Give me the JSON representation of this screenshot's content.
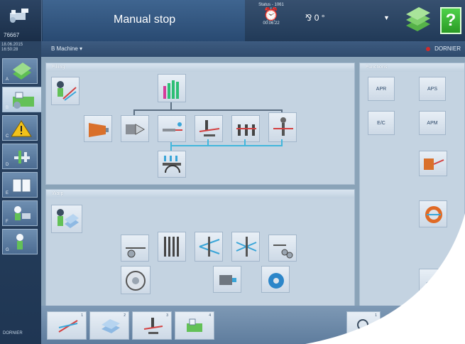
{
  "header": {
    "machine_id": "76667",
    "mode_title": "Manual stop",
    "status_label": "Status - 1061",
    "status_time": "00:06:22",
    "angle": "0 °",
    "help_label": "?"
  },
  "sidebar": {
    "date": "18.06.2015",
    "time": "16:50:28",
    "buttons": [
      {
        "num": "A"
      },
      {
        "num": "B"
      },
      {
        "num": "C"
      },
      {
        "num": "D"
      },
      {
        "num": "E"
      },
      {
        "num": "F"
      },
      {
        "num": "G"
      }
    ],
    "brand": "DORNIER"
  },
  "breadcrumb": {
    "path": "B  Machine  ▾",
    "brand": "DORNIER"
  },
  "panels": {
    "filling_title": "Filling",
    "warp_title": "Warp",
    "functions_title": "Functions",
    "functions": [
      "APR",
      "APS",
      "E/C",
      "APM"
    ]
  },
  "bottombar": {
    "tiles": [
      {
        "num": "1"
      },
      {
        "num": "2"
      },
      {
        "num": "3"
      },
      {
        "num": "4"
      }
    ],
    "search_num": "1"
  },
  "colors": {
    "accent": "#42b6dc",
    "help_green": "#2a9a25",
    "warning": "#f2c21b"
  }
}
